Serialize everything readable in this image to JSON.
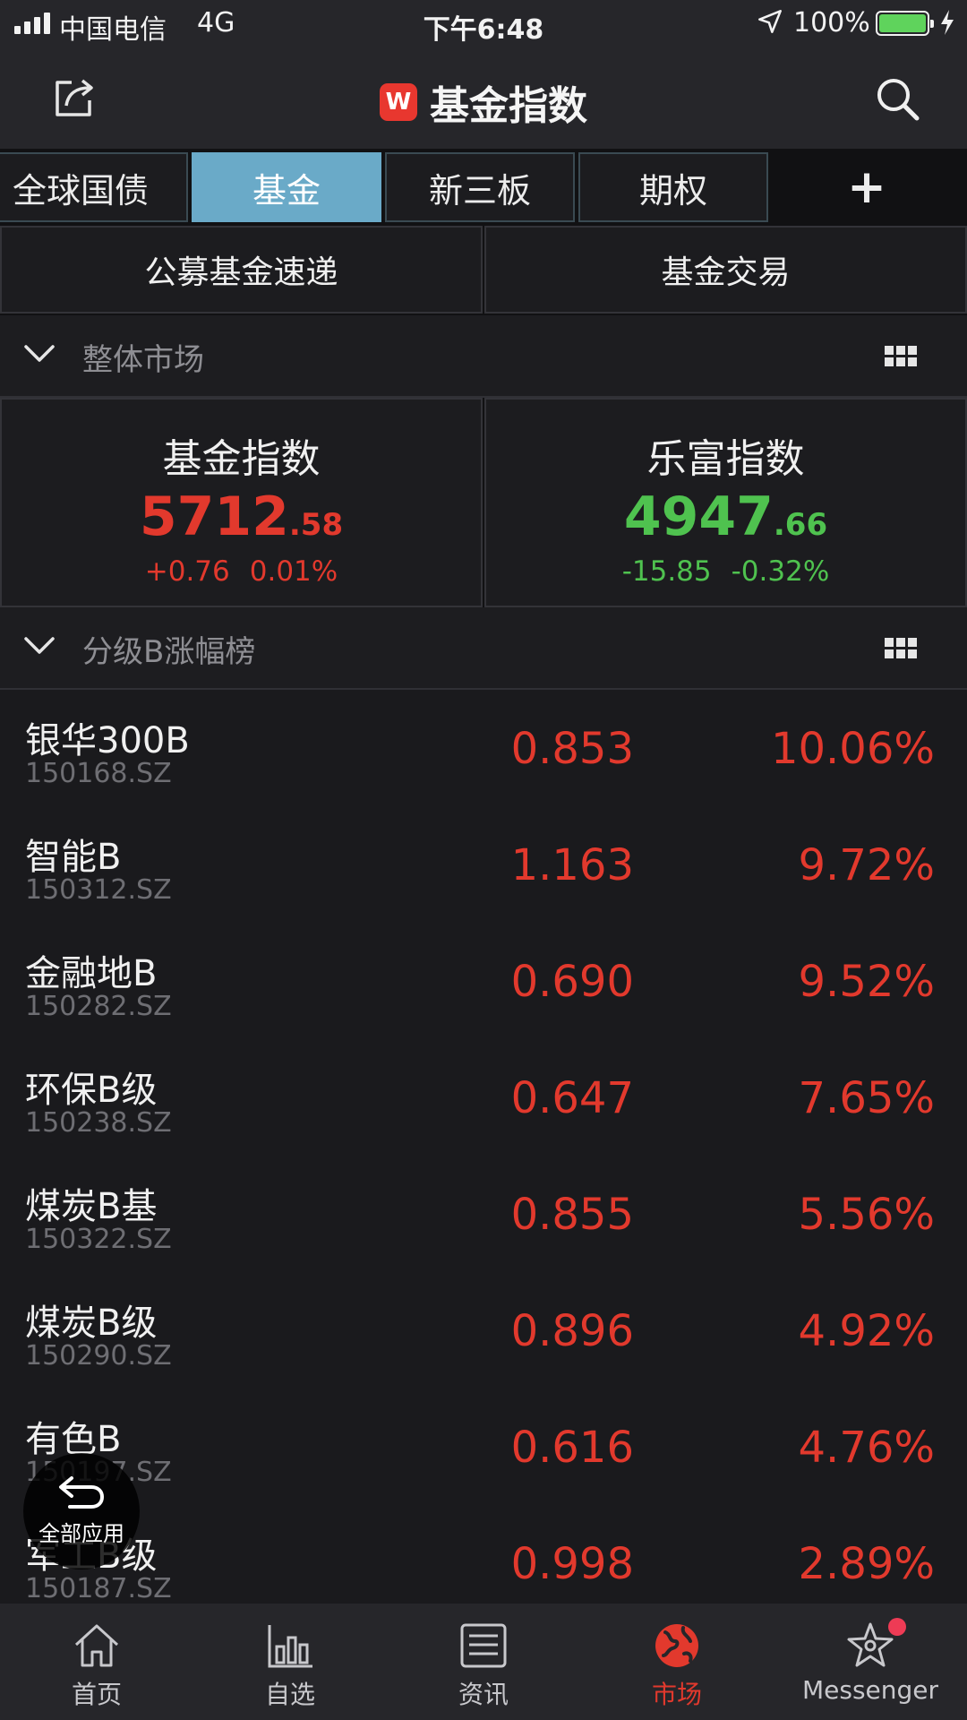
{
  "status_bar": {
    "carrier": "中国电信",
    "network": "4G",
    "time": "下午6:48",
    "battery_pct": "100%"
  },
  "nav": {
    "logo_letter": "W",
    "title": "基金指数"
  },
  "tabs": [
    {
      "label": "全球国债"
    },
    {
      "label": "基金"
    },
    {
      "label": "新三板"
    },
    {
      "label": "期权"
    },
    {
      "label": "+"
    }
  ],
  "sub_tabs": [
    {
      "label": "公募基金速递"
    },
    {
      "label": "基金交易"
    }
  ],
  "sections": {
    "market": {
      "label": "整体市场"
    },
    "ranking": {
      "label": "分级B涨幅榜"
    }
  },
  "indices": [
    {
      "name": "基金指数",
      "value_int": "5712",
      "value_dec": ".58",
      "change": "+0.76",
      "change_pct": "0.01%",
      "trend": "up"
    },
    {
      "name": "乐富指数",
      "value_int": "4947",
      "value_dec": ".66",
      "change": "-15.85",
      "change_pct": "-0.32%",
      "trend": "down"
    }
  ],
  "funds": [
    {
      "name": "银华300B",
      "code": "150168.SZ",
      "price": "0.853",
      "pct": "10.06%"
    },
    {
      "name": "智能B",
      "code": "150312.SZ",
      "price": "1.163",
      "pct": "9.72%"
    },
    {
      "name": "金融地B",
      "code": "150282.SZ",
      "price": "0.690",
      "pct": "9.52%"
    },
    {
      "name": "环保B级",
      "code": "150238.SZ",
      "price": "0.647",
      "pct": "7.65%"
    },
    {
      "name": "煤炭B基",
      "code": "150322.SZ",
      "price": "0.855",
      "pct": "5.56%"
    },
    {
      "name": "煤炭B级",
      "code": "150290.SZ",
      "price": "0.896",
      "pct": "4.92%"
    },
    {
      "name": "有色B",
      "code": "150197.SZ",
      "price": "0.616",
      "pct": "4.76%"
    },
    {
      "name": "军工B级",
      "code": "150187.SZ",
      "price": "0.998",
      "pct": "2.89%"
    }
  ],
  "floating_button": {
    "label": "全部应用"
  },
  "tab_bar": [
    {
      "label": "首页",
      "icon": "home-icon"
    },
    {
      "label": "自选",
      "icon": "bar-chart-icon"
    },
    {
      "label": "资讯",
      "icon": "news-icon"
    },
    {
      "label": "市场",
      "icon": "globe-icon",
      "active": true
    },
    {
      "label": "Messenger",
      "icon": "star-icon",
      "notification_dot": true
    }
  ],
  "colors": {
    "up": "#e2392d",
    "down": "#4fc24f",
    "active_tab": "#6aaac8",
    "logo": "#e8372f",
    "battery": "#5fd35c",
    "notification": "#ee3b55"
  }
}
